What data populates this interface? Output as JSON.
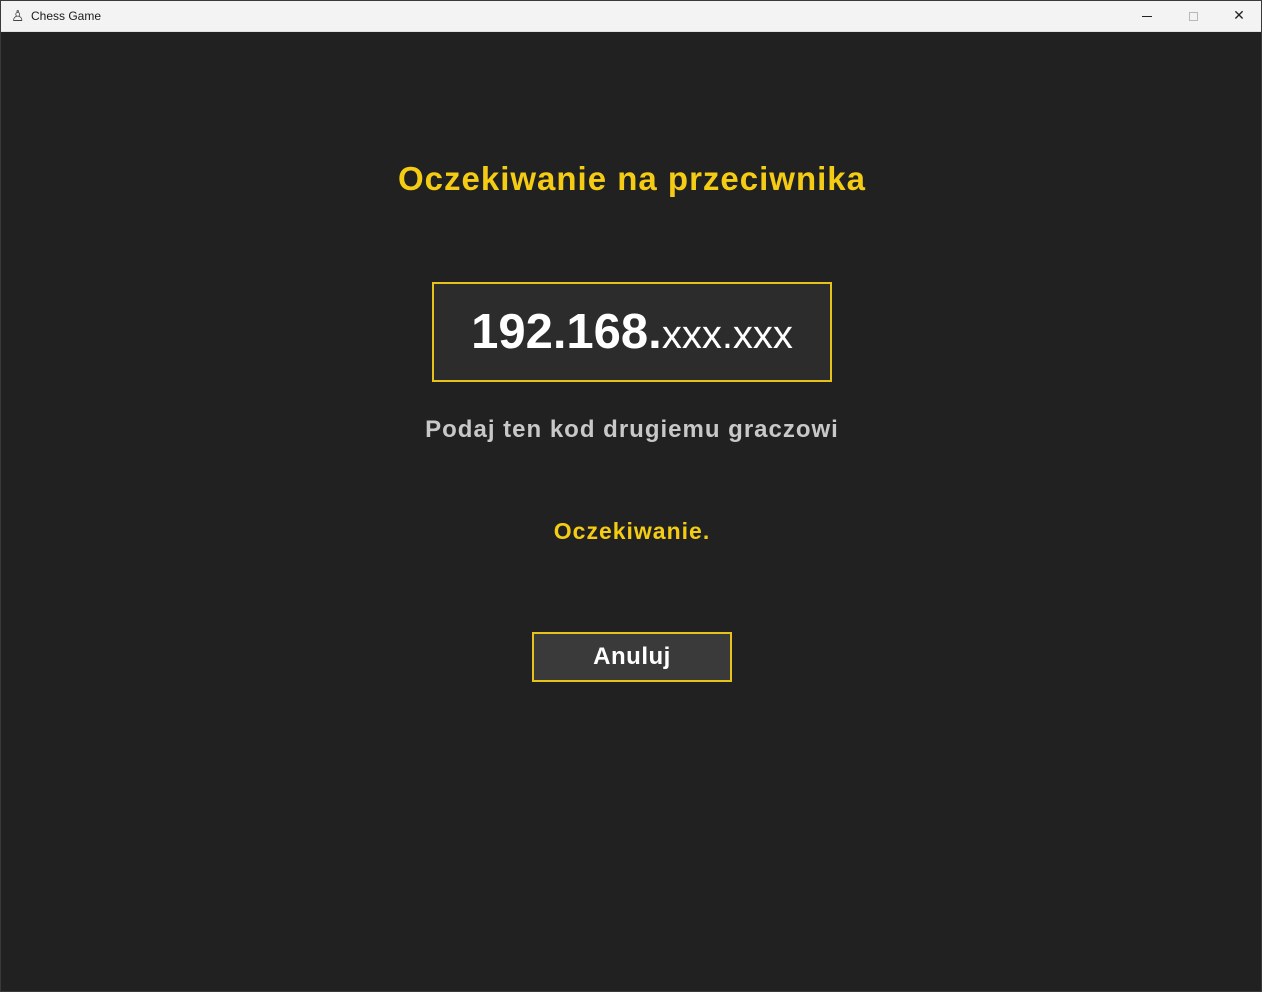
{
  "window": {
    "title": "Chess Game",
    "icon": "chess-pawn-icon"
  },
  "controls": {
    "minimize_icon": "minimize-icon",
    "maximize_icon": "maximize-icon",
    "close_glyph": "✕",
    "close_icon": "close-icon"
  },
  "lobby": {
    "heading": "Oczekiwanie na przeciwnika",
    "code_prefix": "192.168.",
    "code_suffix": "xxx.xxx",
    "hint": "Podaj ten kod drugiemu graczowi",
    "status": "Oczekiwanie.",
    "cancel_label": "Anuluj"
  },
  "colors": {
    "accent": "#f5cc14",
    "background": "#212121",
    "box_background": "#2c2c2c",
    "button_background": "#3a3a3a"
  }
}
